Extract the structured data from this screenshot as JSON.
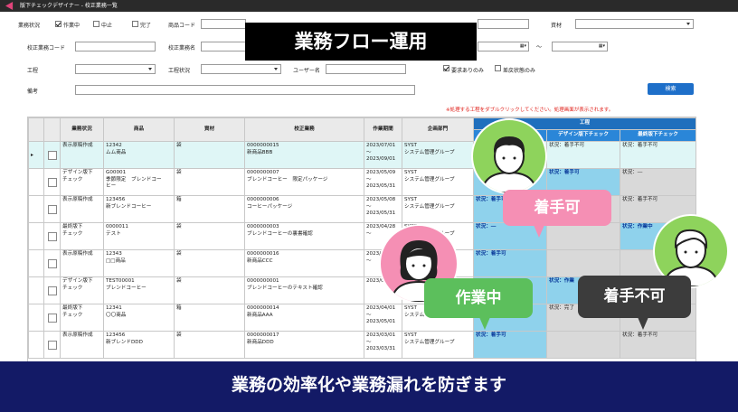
{
  "window": {
    "title": "版下チェックデザイナー - 校正業務一覧"
  },
  "filters": {
    "status_label": "業務状況",
    "status_options": [
      {
        "label": "作業中",
        "checked": true
      },
      {
        "label": "中止",
        "checked": false
      },
      {
        "label": "完了",
        "checked": false
      }
    ],
    "product_code_label": "商品コード",
    "proof_code_label": "校正業務コード",
    "proof_name_label": "校正業務名",
    "process_label": "工程",
    "process_status_label": "工程状況",
    "user_name_label": "ユーザー名",
    "material_label": "資材",
    "date_range_sep": "～",
    "chk_request": {
      "label": "要求ありのみ",
      "checked": true
    },
    "chk_returned": {
      "label": "差戻状態のみ",
      "checked": false
    },
    "remarks_label": "備考",
    "search_button": "検索",
    "note": "※処理する工程をダブルクリックしてください。処理画面が表示されます。"
  },
  "table": {
    "headers": [
      "業務状況",
      "商品",
      "資材",
      "校正業務",
      "作業期間",
      "企画部門"
    ],
    "process_header": "工程",
    "process_sub": [
      "デザイン版下チェック",
      "最終版下チェック"
    ],
    "rows": [
      {
        "status": "表示原稿作成",
        "product": [
          "12342",
          "ムム商品"
        ],
        "material": "袋",
        "proof": [
          "0000000015",
          "新商品BBB"
        ],
        "period": [
          "2023/07/01",
          "～",
          "2023/09/01"
        ],
        "dept": [
          "SYST",
          "システム管理グループ"
        ],
        "p1": "",
        "p2": "状況：着手不可",
        "p3": "状況：着手不可",
        "selected": true
      },
      {
        "status": "デザイン版下\nチェック",
        "product": [
          "G00001",
          "季節限定　ブレンドコー",
          "ヒー"
        ],
        "material": "袋",
        "proof": [
          "0000000007",
          "ブレンドコーヒー　限定パッケージ"
        ],
        "period": [
          "2023/05/09",
          "～",
          "2023/05/31"
        ],
        "dept": [
          "SYST",
          "システム管理グループ"
        ],
        "p1": "",
        "p2": "状況：着手可",
        "p3": "状況：―"
      },
      {
        "status": "表示原稿作成",
        "product": [
          "123456",
          "新ブレンドコーヒー"
        ],
        "material": "箱",
        "proof": [
          "0000000006",
          "コーヒーパッケージ"
        ],
        "period": [
          "2023/05/08",
          "～",
          "2023/05/31"
        ],
        "dept": [
          "SYST",
          "システム管理グループ"
        ],
        "p1": "状況：着手可",
        "p2": "",
        "p3": "状況：着手不可"
      },
      {
        "status": "最終版下\nチェック",
        "product": [
          "0000011",
          "テスト"
        ],
        "material": "袋",
        "proof": [
          "0000000003",
          "ブレンドコーヒーの裏書確認"
        ],
        "period": [
          "2023/04/28",
          "～",
          ""
        ],
        "dept": [
          "SYST",
          "システム管理グループ"
        ],
        "p1": "状況：―",
        "p2": "",
        "p3": "状況：作業中"
      },
      {
        "status": "表示原稿作成",
        "product": [
          "12343",
          "□□商品"
        ],
        "material": "袋",
        "proof": [
          "0000000016",
          "新商品CCC"
        ],
        "period": [
          "2023/",
          "～",
          ""
        ],
        "dept": [
          "",
          ""
        ],
        "p1": "状況：着手可",
        "p2": "",
        "p3": ""
      },
      {
        "status": "デザイン版下\nチェック",
        "product": [
          "TEST00001",
          "ブレンドコーヒー"
        ],
        "material": "袋",
        "proof": [
          "0000000001",
          "ブレンドコーヒーのテキスト確認"
        ],
        "period": [
          "",
          "",
          "2023/05/30"
        ],
        "dept": [
          "",
          ""
        ],
        "p1": "",
        "p2": "状況：作業",
        "p3": ""
      },
      {
        "status": "最終版下\nチェック",
        "product": [
          "12341",
          "〇〇商品"
        ],
        "material": "箱",
        "proof": [
          "0000000014",
          "新商品AAA"
        ],
        "period": [
          "2023/04/01",
          "～",
          "2023/05/01"
        ],
        "dept": [
          "SYST",
          "システム"
        ],
        "p1": "",
        "p2": "状況：完了",
        "p3": ""
      },
      {
        "status": "表示原稿作成",
        "product": [
          "123456",
          "新ブレンドDDD"
        ],
        "material": "袋",
        "proof": [
          "0000000017",
          "新商品DDD"
        ],
        "period": [
          "2023/03/01",
          "～",
          "2023/03/31"
        ],
        "dept": [
          "SYST",
          "システム管理グループ"
        ],
        "p1": "状況：着手可",
        "p2": "",
        "p3": "状況：着手不可"
      }
    ]
  },
  "overlay": {
    "banner": "業務フロー運用",
    "bubble_start_ok": "着手可",
    "bubble_working": "作業中",
    "bubble_start_ng": "着手不可",
    "bottom": "業務の効率化や業務漏れを防ぎます"
  },
  "colors": {
    "accent": "#1e6fc9",
    "navy": "#131a66",
    "pink": "#f58fb4",
    "green": "#5cbf5c",
    "dark": "#3c3c3c",
    "cyan": "#8fd2ec"
  }
}
